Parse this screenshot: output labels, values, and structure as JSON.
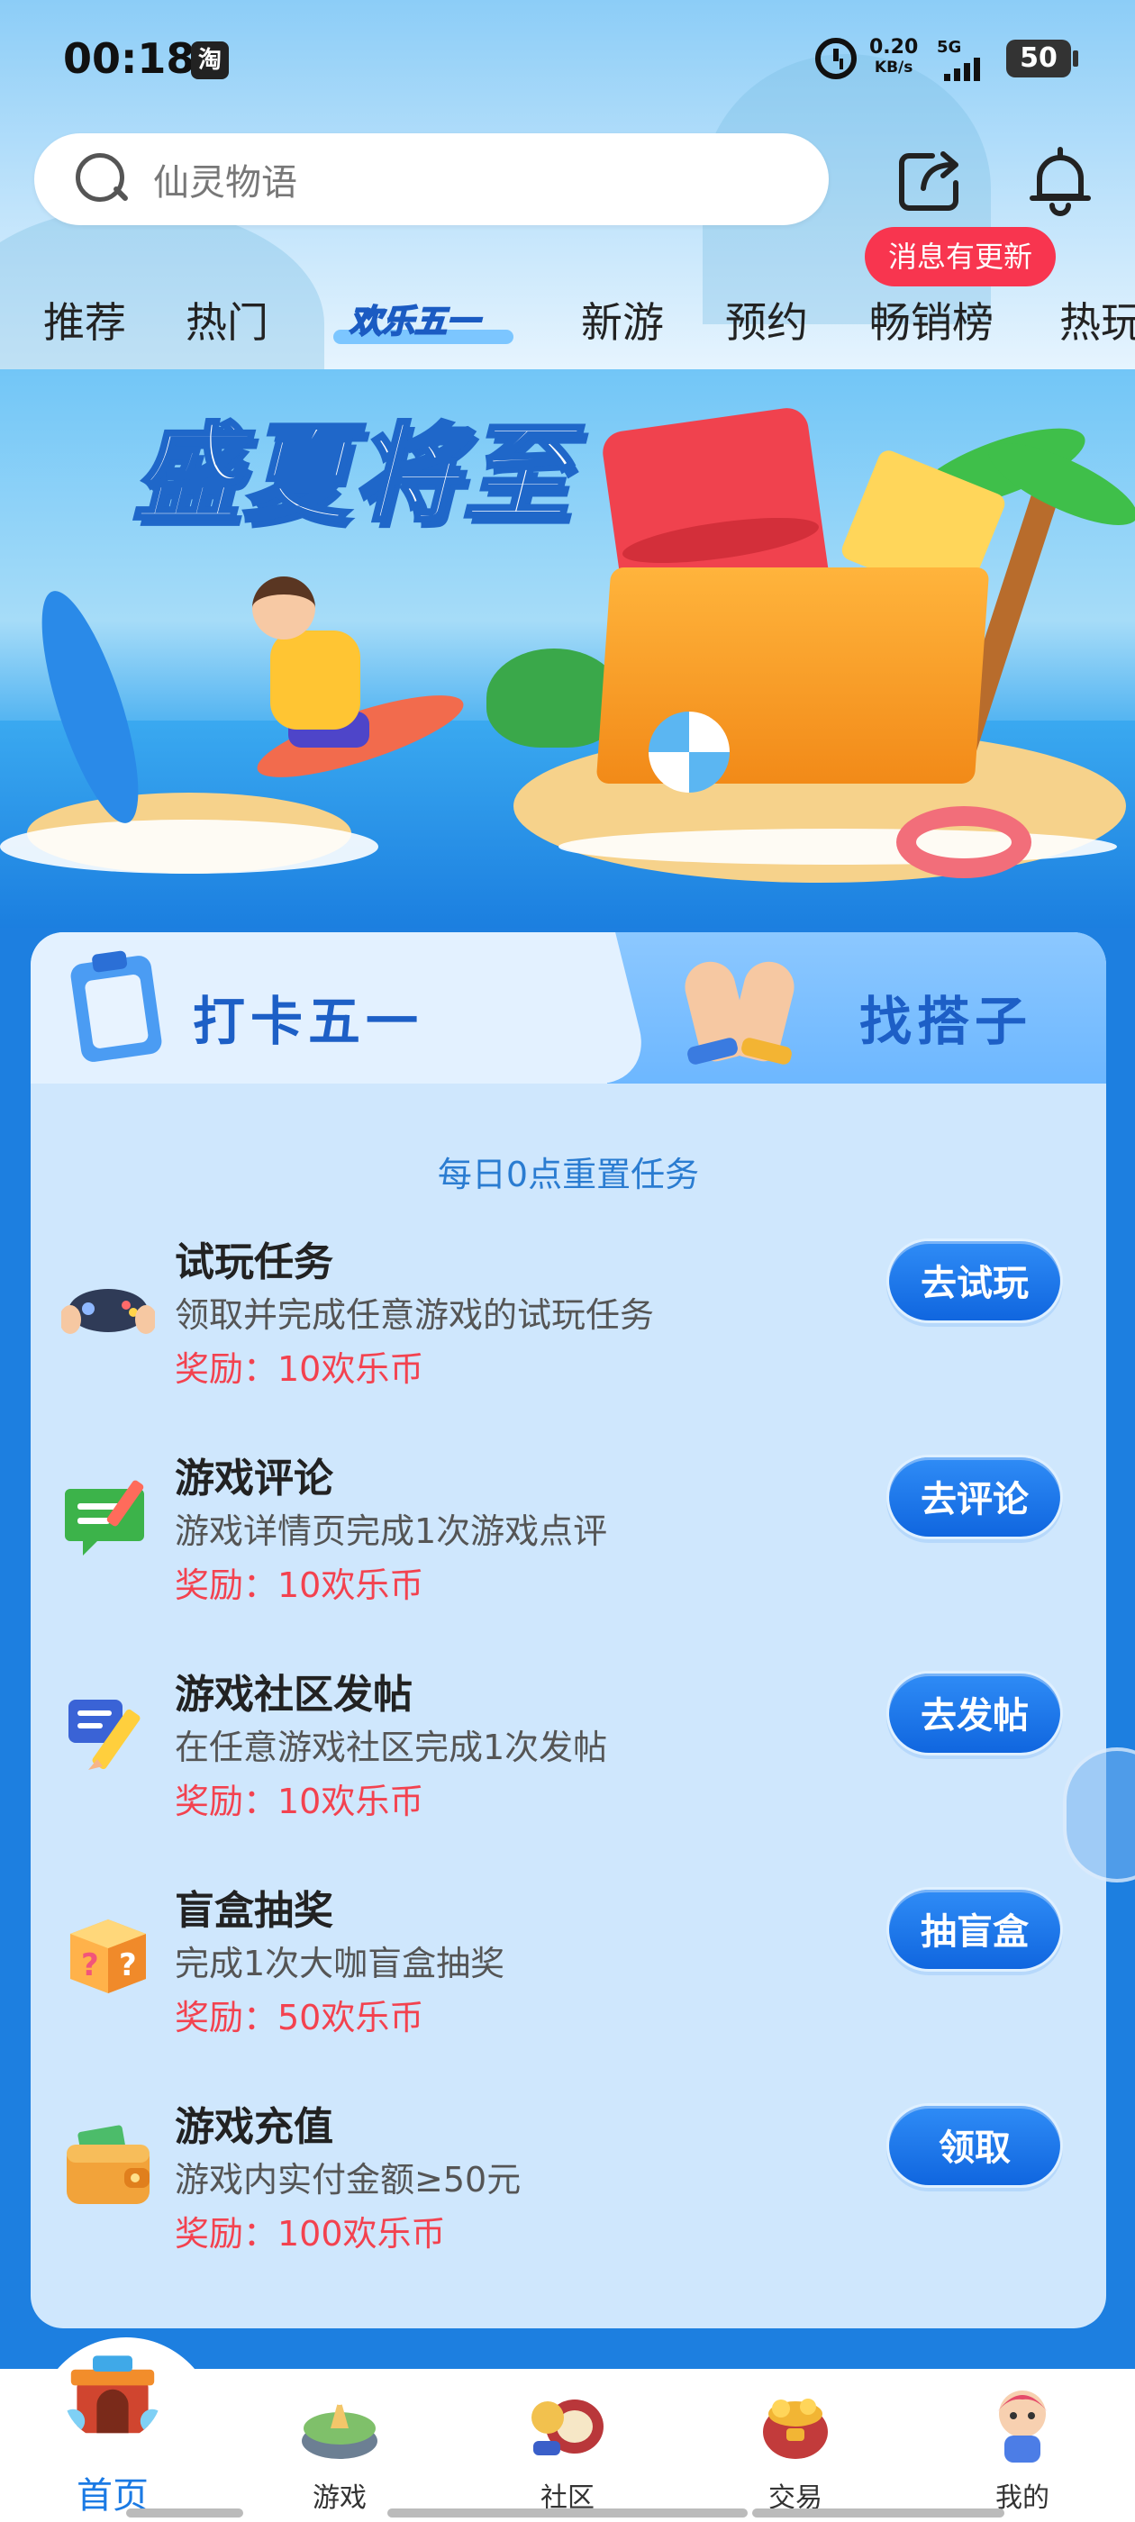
{
  "status_bar": {
    "time": "00:18",
    "app_badge": "淘",
    "net_speed": "0.20",
    "net_unit": "KB/s",
    "network": "5G",
    "battery": "50"
  },
  "search": {
    "placeholder": "仙灵物语"
  },
  "header": {
    "notice_badge": "消息有更新"
  },
  "tabs": [
    {
      "label": "推荐"
    },
    {
      "label": "热门"
    },
    {
      "label": "欢乐五一"
    },
    {
      "label": "新游"
    },
    {
      "label": "预约"
    },
    {
      "label": "畅销榜"
    },
    {
      "label": "热玩"
    }
  ],
  "banner": {
    "title": "盛夏将至"
  },
  "card": {
    "tab_active": "打卡五一",
    "tab_inactive": "找搭子",
    "reset_note": "每日0点重置任务",
    "tasks": [
      {
        "title": "试玩任务",
        "desc": "领取并完成任意游戏的试玩任务",
        "reward": "奖励：10欢乐币",
        "button": "去试玩",
        "icon": "gamepad-icon"
      },
      {
        "title": "游戏评论",
        "desc": "游戏详情页完成1次游戏点评",
        "reward": "奖励：10欢乐币",
        "button": "去评论",
        "icon": "comment-pencil-icon"
      },
      {
        "title": "游戏社区发帖",
        "desc": "在任意游戏社区完成1次发帖",
        "reward": "奖励：10欢乐币",
        "button": "去发帖",
        "icon": "post-pencil-icon"
      },
      {
        "title": "盲盒抽奖",
        "desc": "完成1次大咖盲盒抽奖",
        "reward": "奖励：50欢乐币",
        "button": "抽盲盒",
        "icon": "mystery-box-icon"
      },
      {
        "title": "游戏充值",
        "desc": "游戏内实付金额≥50元",
        "reward": "奖励：100欢乐币",
        "button": "领取",
        "icon": "wallet-icon"
      }
    ]
  },
  "bottom_nav": [
    {
      "label": "首页",
      "active": true
    },
    {
      "label": "游戏",
      "active": false
    },
    {
      "label": "社区",
      "active": false
    },
    {
      "label": "交易",
      "active": false
    },
    {
      "label": "我的",
      "active": false
    }
  ],
  "colors": {
    "accent": "#1b7ae4",
    "reward": "#f3424f",
    "notice": "#f8354f",
    "card_bg": "#cfe7fd"
  }
}
